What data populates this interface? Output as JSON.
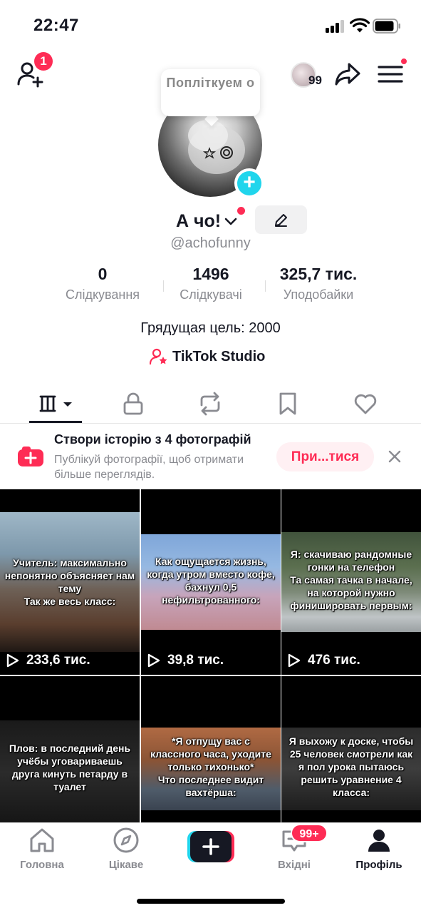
{
  "status_bar": {
    "time": "22:47"
  },
  "header": {
    "add_friend_badge": "1",
    "story_count": "99"
  },
  "profile": {
    "note_bubble": "Попліткуем о",
    "display_name": "А чо!",
    "username": "@achofunny",
    "stats": [
      {
        "value": "0",
        "label": "Слідкування"
      },
      {
        "value": "1496",
        "label": "Слідкувачі"
      },
      {
        "value": "325,7 тис.",
        "label": "Уподобайки"
      }
    ],
    "bio": "Грядущая цель: 2000",
    "studio_label": "TikTok Studio"
  },
  "banner": {
    "title": "Створи історію з 4 фотографій",
    "subtitle": "Публікуй фотографії, щоб отримати більше переглядів.",
    "button": "При...тися"
  },
  "videos": [
    {
      "caption": "Учитель: максимально непонятно объясняет нам тему\nТак же весь класс:",
      "views": "233,6 тис."
    },
    {
      "caption": "Как ощущается жизнь, когда утром вместо кофе, бахнул 0,5 нефильтрованного:",
      "views": "39,8 тис."
    },
    {
      "caption": "Я: скачиваю рандомные гонки на телефон\nТа самая тачка в начале, на которой нужно финишировать первым:",
      "views": "476 тис."
    },
    {
      "caption": "Плов: в последний день учёбы уговариваешь друга кинуть петарду в туалет",
      "views": ""
    },
    {
      "caption": "*Я отпущу вас с классного часа, уходите только тихонько*\nЧто последнее видит вахтёрша:",
      "views": ""
    },
    {
      "caption": "Я выхожу к доске, чтобы 25 человек смотрели как я пол урока пытаюсь решить уравнение 4 класса:",
      "views": ""
    }
  ],
  "bottom_nav": {
    "home": "Головна",
    "discover": "Цікаве",
    "inbox": "Вхідні",
    "inbox_badge": "99+",
    "profile": "Профіль"
  },
  "colors": {
    "accent": "#fe2c55",
    "cyan": "#20d5ec",
    "text": "#161823",
    "muted": "#8a8b91"
  },
  "icons": [
    "add-friend-icon",
    "share-icon",
    "menu-icon",
    "edit-icon",
    "chevron-down-icon",
    "grid-icon",
    "lock-icon",
    "repost-icon",
    "bookmark-icon",
    "heart-icon",
    "play-icon",
    "close-icon",
    "home-icon",
    "compass-icon",
    "plus-icon",
    "inbox-icon",
    "profile-icon"
  ]
}
